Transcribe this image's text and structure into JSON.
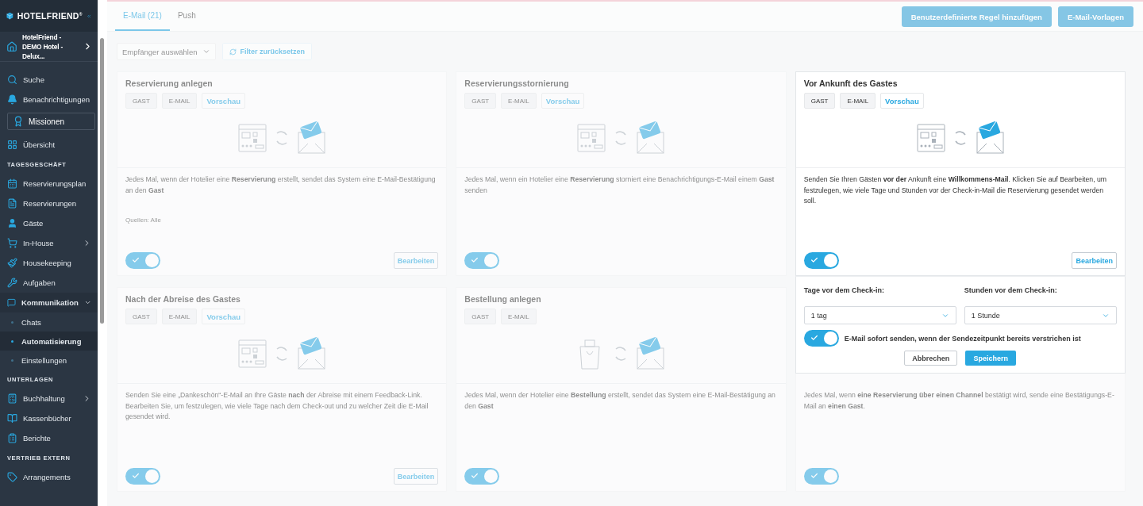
{
  "sidebar": {
    "brand": "HOTELFRIEND$^{®}$",
    "hotel": "HotelFriend - DEMO Hotel - Delux...",
    "nav": [
      {
        "kind": "link",
        "label": "Suche"
      },
      {
        "kind": "link",
        "label": "Benachrichtigungen"
      },
      {
        "kind": "boxed",
        "label": "Missionen"
      },
      {
        "kind": "link",
        "label": "Übersicht"
      },
      {
        "kind": "section",
        "label": "TAGESGESCHÄFT"
      },
      {
        "kind": "link",
        "label": "Reservierungsplan"
      },
      {
        "kind": "link",
        "label": "Reservierungen"
      },
      {
        "kind": "link",
        "label": "Gäste"
      },
      {
        "kind": "link",
        "label": "In-House",
        "expanded": false
      },
      {
        "kind": "link",
        "label": "Housekeeping"
      },
      {
        "kind": "link",
        "label": "Aufgaben"
      },
      {
        "kind": "link",
        "label": "Kommunikation",
        "expanded": true,
        "children": [
          {
            "label": "Chats",
            "selected": false
          },
          {
            "label": "Automatisierung",
            "selected": true
          },
          {
            "label": "Einstellungen",
            "selected": false
          }
        ]
      },
      {
        "kind": "section",
        "label": "UNTERLAGEN"
      },
      {
        "kind": "link",
        "label": "Buchhaltung",
        "expanded": false
      },
      {
        "kind": "link",
        "label": "Kassenbücher"
      },
      {
        "kind": "link",
        "label": "Berichte"
      },
      {
        "kind": "section",
        "label": "VERTRIEB EXTERN"
      },
      {
        "kind": "link",
        "label": "Arrangements"
      }
    ]
  },
  "tabs": [
    {
      "label": "E-Mail (21)",
      "selected": true
    },
    {
      "label": "Push",
      "selected": false
    }
  ],
  "actions": [
    "Benutzerdefinierte Regel hinzufügen",
    "E-Mail-Vorlagen"
  ],
  "filters": {
    "recipient": {
      "placeholder": "Empfänger auswählen"
    },
    "reset": "Filter zurücksetzen"
  },
  "cards": [
    {
      "title": "Reservierung anlegen",
      "kind": "reservation",
      "focused": false,
      "tags": [
        "GAST",
        "E-MAIL"
      ],
      "preview": "Vorschau",
      "description": "Jedes Mal, wenn der Hotelier eine **Reservierung** erstellt, sendet das System eine E-Mail-Bestätigung an den **Gast**",
      "sources": "Quellen: Alle",
      "on": true,
      "edit": "Bearbeiten"
    },
    {
      "title": "Reservierungsstornierung",
      "kind": "reservation",
      "focused": false,
      "tags": [
        "GAST",
        "E-MAIL"
      ],
      "preview": "Vorschau",
      "description": "Jedes Mal, wenn ein Hotelier eine **Reservierung** storniert eine Benachrichtigungs-E-Mail einem **Gast** senden",
      "on": true
    },
    {
      "title": "Vor Ankunft des Gastes",
      "kind": "reservation",
      "focused": true,
      "tags": [
        "GAST",
        "E-MAIL"
      ],
      "preview": "Vorschau",
      "description": "Senden Sie Ihren Gästen **vor der** Ankunft eine **Willkommens-Mail**. Klicken Sie auf Bearbeiten, um festzulegen, wie viele Tage und Stunden vor der Check-in-Mail die Reservierung gesendet werden soll.",
      "on": true,
      "edit": "Bearbeiten",
      "settings": {
        "days_label": "Tage vor dem Check-in:",
        "days": "1 tag",
        "hours_label": "Stunden vor dem Check-in:",
        "hours": "1 Stunde",
        "send_now": {
          "label": "E-Mail sofort senden, wenn der Sendezeitpunkt bereits verstrichen ist",
          "on": true
        },
        "cancel": "Abbrechen",
        "save": "Speichern"
      }
    },
    {
      "title": "Nach der Abreise des Gastes",
      "kind": "reservation",
      "focused": false,
      "tags": [
        "GAST",
        "E-MAIL"
      ],
      "preview": "Vorschau",
      "description": "Senden Sie eine „Dankeschön“-E-Mail an Ihre Gäste **nach** der Abreise mit einem Feedback-Link. Bearbeiten Sie, um festzulegen, wie viele Tage nach dem Check-out und zu welcher Zeit die E-Mail gesendet wird.",
      "on": true,
      "edit": "Bearbeiten"
    },
    {
      "title": "Bestellung anlegen",
      "kind": "order",
      "focused": false,
      "tags": [
        "GAST",
        "E-MAIL"
      ],
      "description": "Jedes Mal, wenn der Hotelier eine **Bestellung** erstellt, sendet das System eine E-Mail-Bestätigung an den **Gast**",
      "on": true
    },
    {
      "kind": "covered",
      "focused": false,
      "description": "Jedes Mal, wenn **eine Reservierung über einen Channel** bestätigt wird, sende eine Bestätigungs-E-Mail an **einen Gast**.",
      "on": true
    }
  ]
}
